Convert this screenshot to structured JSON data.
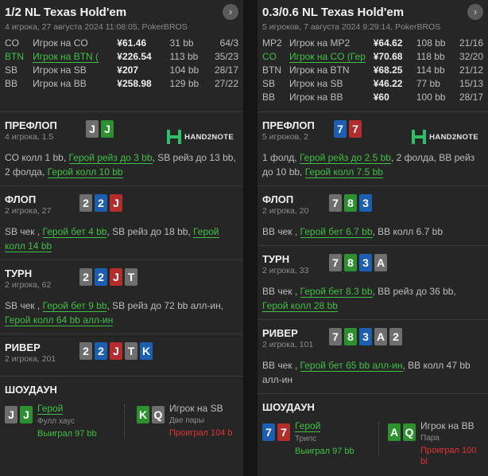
{
  "hands": [
    {
      "title": "1/2 NL Texas Hold'em",
      "subtitle": "4 игрока, 27 августа 2024 11:08:05, PokerBROS",
      "players": [
        {
          "pos": "CO",
          "name": "Игрок на CO",
          "stack": "¥61.46",
          "bb": "31 bb",
          "stat": "64/3",
          "hero": false
        },
        {
          "pos": "BTN",
          "name": "Игрок на BTN (",
          "stack": "¥226.54",
          "bb": "113 bb",
          "stat": "35/23",
          "hero": true
        },
        {
          "pos": "SB",
          "name": "Игрок на SB",
          "stack": "¥207",
          "bb": "104 bb",
          "stat": "28/17",
          "hero": false
        },
        {
          "pos": "BB",
          "name": "Игрок на BB",
          "stack": "¥258.98",
          "bb": "129 bb",
          "stat": "27/22",
          "hero": false
        }
      ],
      "streets": [
        {
          "name": "ПРЕФЛОП",
          "sub": "4 игрока, 1.5",
          "cards": [
            {
              "r": "J",
              "c": "g"
            },
            {
              "r": "J",
              "c": "gr"
            }
          ],
          "logo": "HAND2NOTE",
          "action": [
            {
              "t": "CO колл 1 bb, ",
              "h": false
            },
            {
              "t": "Герой рейз до 3 bb",
              "h": true
            },
            {
              "t": ", SB рейз до 13 bb, 2 фолда, ",
              "h": false
            },
            {
              "t": "Герой колл 10 bb",
              "h": true
            }
          ]
        },
        {
          "name": "ФЛОП",
          "sub": "2 игрока, 27",
          "cards": [
            {
              "r": "2",
              "c": "g"
            },
            {
              "r": "2",
              "c": "b"
            },
            {
              "r": "J",
              "c": "r"
            }
          ],
          "action": [
            {
              "t": "SB чек , ",
              "h": false
            },
            {
              "t": "Герой бет 4 bb",
              "h": true
            },
            {
              "t": ", SB рейз до 18 bb, ",
              "h": false
            },
            {
              "t": "Герой колл 14 bb",
              "h": true
            }
          ]
        },
        {
          "name": "ТУРН",
          "sub": "2 игрока, 62",
          "cards": [
            {
              "r": "2",
              "c": "g"
            },
            {
              "r": "2",
              "c": "b"
            },
            {
              "r": "J",
              "c": "r"
            },
            {
              "r": "T",
              "c": "g"
            }
          ],
          "action": [
            {
              "t": "SB чек , ",
              "h": false
            },
            {
              "t": "Герой бет 9 bb",
              "h": true
            },
            {
              "t": ", SB рейз до 72 bb алл-ин, ",
              "h": false
            },
            {
              "t": "Герой колл 64 bb алл-ин",
              "h": true
            }
          ]
        },
        {
          "name": "РИВЕР",
          "sub": "2 игрока, 201",
          "cards": [
            {
              "r": "2",
              "c": "g"
            },
            {
              "r": "2",
              "c": "b"
            },
            {
              "r": "J",
              "c": "r"
            },
            {
              "r": "T",
              "c": "g"
            },
            {
              "r": "K",
              "c": "b"
            }
          ],
          "action": []
        }
      ],
      "showdown": {
        "title": "ШОУДАУН",
        "hero": {
          "cards": [
            {
              "r": "J",
              "c": "g"
            },
            {
              "r": "J",
              "c": "gr"
            }
          ],
          "name": "Герой",
          "hand": "Фулл хаус",
          "result": "Выиграл 97 bb"
        },
        "villain": {
          "cards": [
            {
              "r": "K",
              "c": "gr"
            },
            {
              "r": "Q",
              "c": "g"
            }
          ],
          "name": "Игрок на SB",
          "hand": "Две пары",
          "result": "Проиграл 104 b"
        }
      }
    },
    {
      "title": "0.3/0.6 NL Texas Hold'em",
      "subtitle": "5 игроков, 7 августа 2024 9:29:14, PokerBROS",
      "players": [
        {
          "pos": "MP2",
          "name": "Игрок на MP2",
          "stack": "¥64.62",
          "bb": "108 bb",
          "stat": "21/16",
          "hero": false
        },
        {
          "pos": "CO",
          "name": "Игрок на CO (Гер",
          "stack": "¥70.68",
          "bb": "118 bb",
          "stat": "32/20",
          "hero": true
        },
        {
          "pos": "BTN",
          "name": "Игрок на BTN",
          "stack": "¥68.25",
          "bb": "114 bb",
          "stat": "21/12",
          "hero": false
        },
        {
          "pos": "SB",
          "name": "Игрок на SB",
          "stack": "¥46.22",
          "bb": "77 bb",
          "stat": "15/13",
          "hero": false
        },
        {
          "pos": "BB",
          "name": "Игрок на BB",
          "stack": "¥60",
          "bb": "100 bb",
          "stat": "28/17",
          "hero": false
        }
      ],
      "streets": [
        {
          "name": "ПРЕФЛОП",
          "sub": "5 игроков, 2",
          "cards": [
            {
              "r": "7",
              "c": "b"
            },
            {
              "r": "7",
              "c": "r"
            }
          ],
          "logo": "HAND2NOTE",
          "action": [
            {
              "t": "1 фолд, ",
              "h": false
            },
            {
              "t": "Герой рейз до 2.5 bb",
              "h": true
            },
            {
              "t": ", 2 фолда, BB рейз до 10 bb, ",
              "h": false
            },
            {
              "t": "Герой колл 7.5 bb",
              "h": true
            }
          ]
        },
        {
          "name": "ФЛОП",
          "sub": "2 игрока, 20",
          "cards": [
            {
              "r": "7",
              "c": "g"
            },
            {
              "r": "8",
              "c": "gr"
            },
            {
              "r": "3",
              "c": "b"
            }
          ],
          "action": [
            {
              "t": "BB чек , ",
              "h": false
            },
            {
              "t": "Герой бет 6.7 bb",
              "h": true
            },
            {
              "t": ", BB колл 6.7 bb",
              "h": false
            }
          ]
        },
        {
          "name": "ТУРН",
          "sub": "2 игрока, 33",
          "cards": [
            {
              "r": "7",
              "c": "g"
            },
            {
              "r": "8",
              "c": "gr"
            },
            {
              "r": "3",
              "c": "b"
            },
            {
              "r": "A",
              "c": "g"
            }
          ],
          "action": [
            {
              "t": "BB чек , ",
              "h": false
            },
            {
              "t": "Герой бет 8.3 bb",
              "h": true
            },
            {
              "t": ", BB рейз до 36 bb, ",
              "h": false
            },
            {
              "t": "Герой колл 28 bb",
              "h": true
            }
          ]
        },
        {
          "name": "РИВЕР",
          "sub": "2 игрока, 101",
          "cards": [
            {
              "r": "7",
              "c": "g"
            },
            {
              "r": "8",
              "c": "gr"
            },
            {
              "r": "3",
              "c": "b"
            },
            {
              "r": "A",
              "c": "g"
            },
            {
              "r": "2",
              "c": "g"
            }
          ],
          "action": [
            {
              "t": "BB чек , ",
              "h": false
            },
            {
              "t": "Герой бет 65 bb алл-ин",
              "h": true
            },
            {
              "t": ", BB колл 47 bb алл-ин",
              "h": false
            }
          ]
        }
      ],
      "showdown": {
        "title": "ШОУДАУН",
        "hero": {
          "cards": [
            {
              "r": "7",
              "c": "b"
            },
            {
              "r": "7",
              "c": "r"
            }
          ],
          "name": "Герой",
          "hand": "Трипс",
          "result": "Выиграл 97 bb"
        },
        "villain": {
          "cards": [
            {
              "r": "A",
              "c": "gr"
            },
            {
              "r": "Q",
              "c": "gr"
            }
          ],
          "name": "Игрок на BB",
          "hand": "Пара",
          "result": "Проиграл 100 bl"
        }
      }
    }
  ],
  "icons": {
    "chevron": "chevron-right-icon",
    "logo": "hand2note-logo"
  },
  "colors": {
    "hero": "#3fc044",
    "lose": "#e03535",
    "card_blue": "#1c5fb0",
    "card_red": "#b42d2d",
    "card_green": "#2d9130",
    "card_gray": "#6e6e6e"
  }
}
